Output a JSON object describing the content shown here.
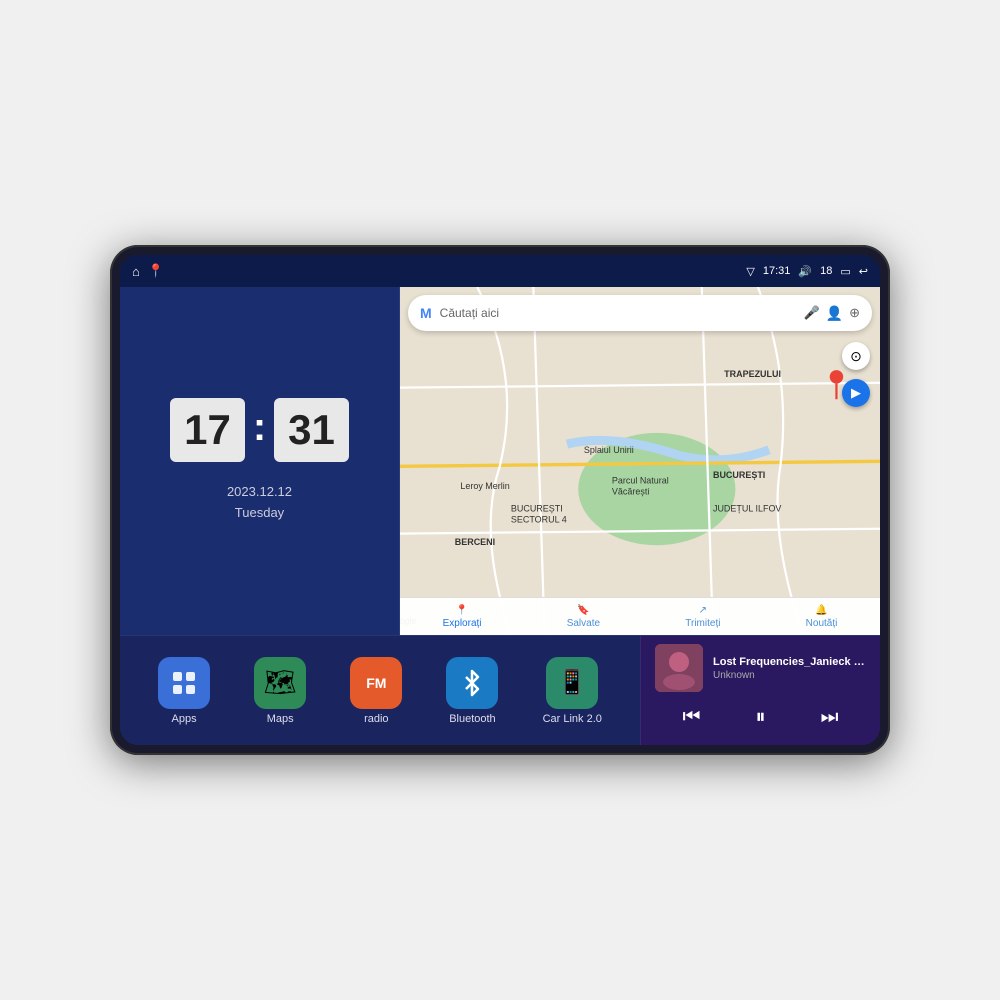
{
  "device": {
    "status_bar": {
      "signal_icon": "▽",
      "time": "17:31",
      "volume_icon": "🔊",
      "battery_level": "18",
      "battery_icon": "🔋",
      "back_icon": "↩"
    },
    "home_icon": "⌂",
    "maps_shortcut_icon": "📍"
  },
  "clock": {
    "hours": "17",
    "minutes": "31",
    "date": "2023.12.12",
    "day": "Tuesday"
  },
  "map": {
    "search_placeholder": "Căutați aici",
    "tabs": [
      {
        "label": "Explorați",
        "active": true
      },
      {
        "label": "Salvate",
        "active": false
      },
      {
        "label": "Trimiteți",
        "active": false
      },
      {
        "label": "Noutăți",
        "active": false
      }
    ],
    "labels": [
      "TRAPEZULUI",
      "BUCUREȘTI",
      "JUDEȚUL ILFOV",
      "BERCENI",
      "Parcul Natural Văcărești",
      "Leroy Merlin",
      "BUCUREȘTI SECTORUL 4",
      "Splaiul Unirii",
      "Google"
    ]
  },
  "apps": [
    {
      "id": "apps",
      "label": "Apps",
      "icon": "⚏",
      "color": "#3a6fd8"
    },
    {
      "id": "maps",
      "label": "Maps",
      "icon": "🗺",
      "color": "#2e8b57"
    },
    {
      "id": "radio",
      "label": "radio",
      "icon": "📻",
      "color": "#e55a2b"
    },
    {
      "id": "bluetooth",
      "label": "Bluetooth",
      "icon": "🔷",
      "color": "#1a7ac4"
    },
    {
      "id": "carlink",
      "label": "Car Link 2.0",
      "icon": "📱",
      "color": "#2a8a6a"
    }
  ],
  "music": {
    "title": "Lost Frequencies_Janieck Devy-...",
    "artist": "Unknown",
    "prev_label": "⏮",
    "play_label": "⏸",
    "next_label": "⏭"
  }
}
